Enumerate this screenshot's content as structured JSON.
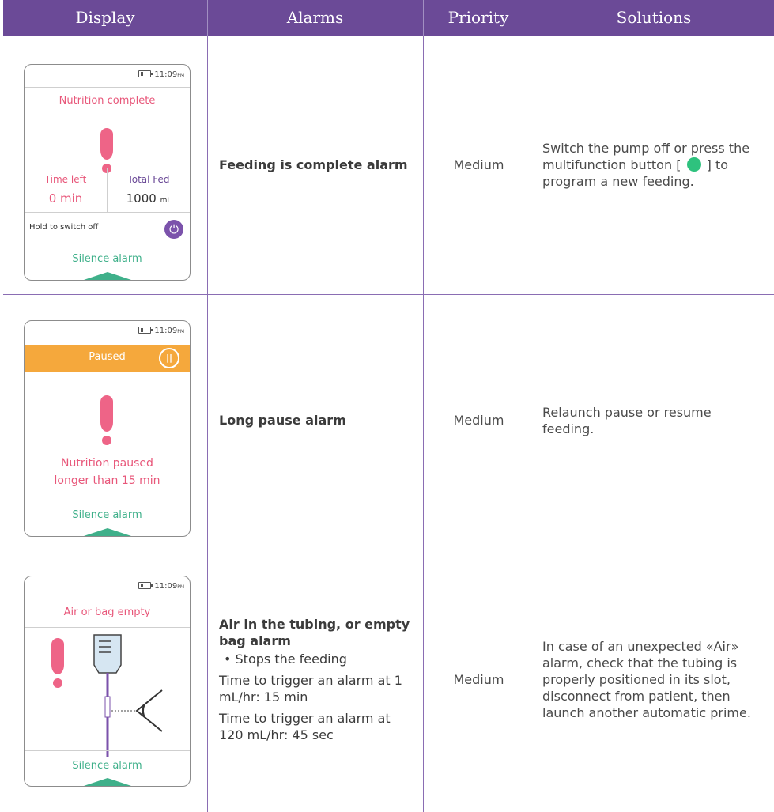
{
  "header": {
    "cols": [
      "Display",
      "Alarms",
      "Priority",
      "Solutions"
    ]
  },
  "rows": [
    {
      "alarm": "Feeding is complete alarm",
      "priority": "Medium",
      "solution_before_icon": "Switch the pump off or press the multifunction button [",
      "solution_after_icon": "] to program a new feeding.",
      "screen": {
        "time": "11:09",
        "time_suffix": "PM",
        "title": "Nutrition complete",
        "time_left_label": "Time left",
        "time_left_value": "0 min",
        "total_fed_label": "Total Fed",
        "total_fed_value": "1000",
        "total_fed_unit": "mL",
        "hold_text": "Hold to switch off",
        "silence": "Silence alarm"
      }
    },
    {
      "alarm": "Long pause alarm",
      "priority": "Medium",
      "solution": "Relaunch pause or resume feeding.",
      "screen": {
        "time": "11:09",
        "time_suffix": "PM",
        "banner": "Paused",
        "message_line1": "Nutrition paused",
        "message_line2": "longer than 15 min",
        "silence": "Silence alarm"
      }
    },
    {
      "alarm": "Air in the tubing, or empty bag alarm",
      "bullet": "• Stops the feeding",
      "detail1": "Time to trigger an alarm at 1 mL/hr: 15 min",
      "detail2": "Time to trigger an alarm at 120 mL/hr: 45 sec",
      "priority": "Medium",
      "solution": "In case of an unexpected «Air» alarm, check that the tubing is properly positioned in its slot, disconnect from patient, then launch another automatic prime.",
      "screen": {
        "time": "11:09",
        "time_suffix": "PM",
        "title": "Air or bag empty",
        "silence": "Silence alarm"
      }
    }
  ],
  "colors": {
    "header_bg": "#6b4a97",
    "rule": "#8a6db3",
    "alarm_pink": "#ee6487",
    "silence_green": "#3fb08a",
    "paused_orange": "#f5a83c",
    "button_green": "#2ec27e"
  },
  "icons": [
    "battery-icon",
    "exclamation-icon",
    "power-icon",
    "pause-icon",
    "green-button-icon",
    "feeding-bag-icon",
    "eye-sensor-icon"
  ]
}
